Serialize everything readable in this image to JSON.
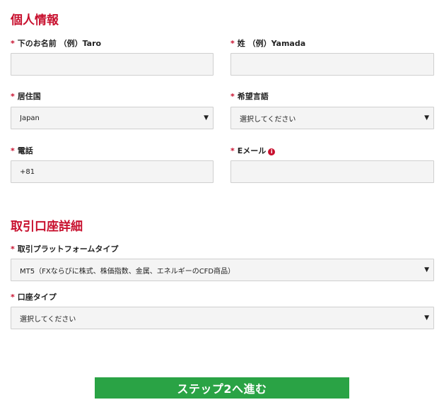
{
  "personal": {
    "title": "個人情報",
    "first_name": {
      "label": "下のお名前 （例）Taro",
      "value": ""
    },
    "last_name": {
      "label": "姓 （例）Yamada",
      "value": ""
    },
    "country": {
      "label": "居住国",
      "value": "Japan"
    },
    "language": {
      "label": "希望言語",
      "value": "選択してください"
    },
    "phone": {
      "label": "電話",
      "value": "+81"
    },
    "email": {
      "label": "Eメール",
      "value": "",
      "info_icon": "i"
    }
  },
  "account": {
    "title": "取引口座詳細",
    "platform": {
      "label": "取引プラットフォームタイプ",
      "value": "MT5（FXならびに株式、株価指数、金属、エネルギーのCFD商品）"
    },
    "account_type": {
      "label": "口座タイプ",
      "value": "選択してください"
    }
  },
  "required_mark": "*",
  "caret": "▼",
  "submit_label": "ステップ2へ進む",
  "colors": {
    "accent_red": "#c8102e",
    "submit_green": "#2aa345",
    "field_bg": "#f4f4f4",
    "field_border": "#cfcfcf"
  }
}
